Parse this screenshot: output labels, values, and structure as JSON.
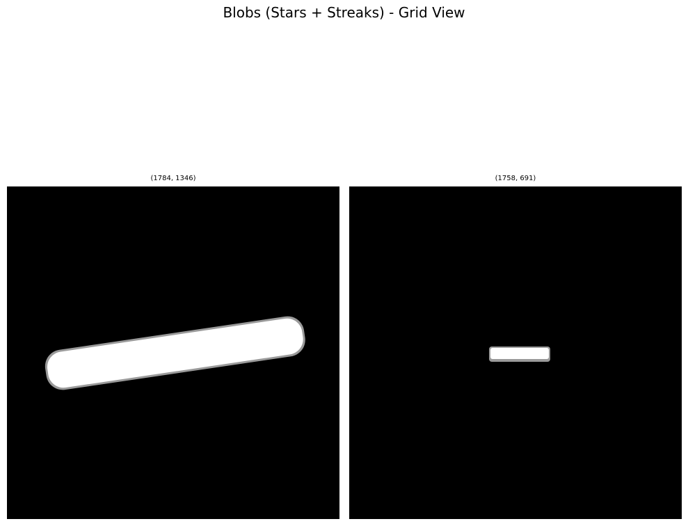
{
  "figure": {
    "title": "Blobs (Stars + Streaks) - Grid View"
  },
  "panels": [
    {
      "title": "(1784, 1346)"
    },
    {
      "title": "(1758, 691)"
    }
  ],
  "colors": {
    "background": "#000000",
    "blob": "#ffffff",
    "blob_edge": "#9a9a9a"
  }
}
